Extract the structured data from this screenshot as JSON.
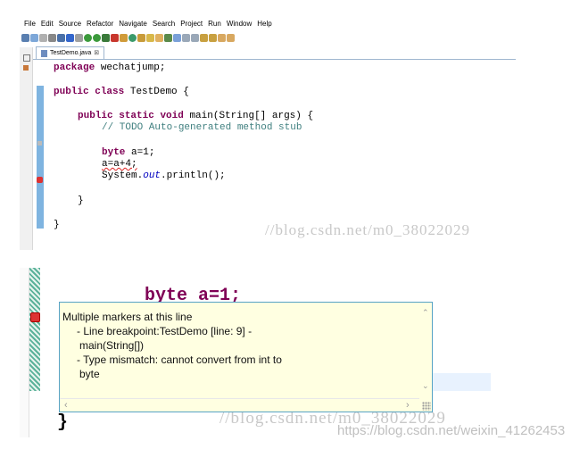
{
  "menu": [
    "File",
    "Edit",
    "Source",
    "Refactor",
    "Navigate",
    "Search",
    "Project",
    "Run",
    "Window",
    "Help"
  ],
  "tab": {
    "filename": "TestDemo.java",
    "close": "⊠"
  },
  "code": [
    {
      "parts": [
        [
          "kw",
          "package"
        ],
        [
          "",
          "wechatjump;"
        ]
      ]
    },
    {
      "parts": [
        [
          "kw",
          "public"
        ],
        [
          "",
          ""
        ],
        [
          "kw",
          "class"
        ],
        [
          "",
          "TestDemo {"
        ]
      ]
    },
    {
      "parts": [
        [
          "kw",
          "public"
        ],
        [
          "kw",
          "static"
        ],
        [
          "kw",
          "void"
        ],
        [
          "",
          "main(String[] args) {"
        ]
      ]
    },
    {
      "parts": [
        [
          "cm",
          "// TODO Auto-generated method stub"
        ]
      ]
    },
    {
      "parts": [
        [
          "kw",
          "byte"
        ],
        [
          "",
          "a=1;"
        ]
      ]
    },
    {
      "parts": [
        [
          "",
          "a=a+4;"
        ]
      ]
    },
    {
      "parts": [
        [
          "",
          "System."
        ],
        [
          "it",
          "out"
        ],
        [
          "",
          ".println();"
        ]
      ]
    },
    {
      "parts": [
        [
          "",
          "}"
        ]
      ]
    },
    {
      "parts": [
        [
          "",
          "}"
        ]
      ]
    }
  ],
  "watermark_top": "//blog.csdn.net/m0_38022029",
  "watermark_bottom": "//blog.csdn.net/m0_38022029",
  "watermark_corner": "https://blog.csdn.net/weixin_41262453",
  "zoom_code": "byte a=1;",
  "zoom_brace": "}",
  "tooltip": {
    "title": "Multiple markers at this line",
    "lines": [
      "- Line breakpoint:TestDemo [line: 9] -",
      "main(String[])",
      "- Type mismatch: cannot convert from int to",
      "byte"
    ]
  }
}
